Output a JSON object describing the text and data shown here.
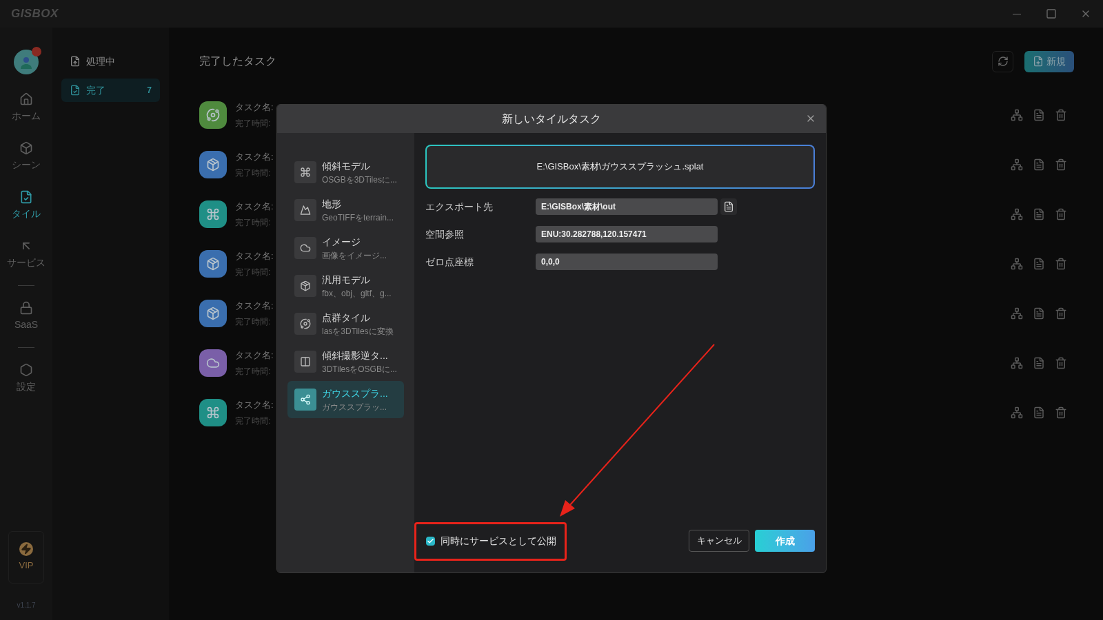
{
  "app": {
    "logo": "GISBOX"
  },
  "avatar": {
    "notification": true
  },
  "nav": {
    "items": [
      {
        "label": "ホーム",
        "selected": false
      },
      {
        "label": "シーン",
        "selected": false
      },
      {
        "label": "タイル",
        "selected": true
      },
      {
        "label": "サービス",
        "selected": false
      }
    ],
    "extra_items": [
      {
        "label": "SaaS",
        "selected": false
      },
      {
        "label": "設定",
        "selected": false
      }
    ]
  },
  "vip": {
    "label": "VIP"
  },
  "version": "v1.1.7",
  "categories": [
    {
      "label": "処理中",
      "selected": false
    },
    {
      "label": "完了",
      "count": "7",
      "selected": true
    }
  ],
  "main": {
    "title": "完了したタスク",
    "new_button": "新規",
    "tasks": [
      {
        "kind": "point_cloud",
        "color": "#4f8a3e",
        "name_label": "タスク名:",
        "time_label": "完了時間:"
      },
      {
        "kind": "model",
        "color": "#3a6eae",
        "name_label": "タスク名:",
        "time_label": "完了時間:"
      },
      {
        "kind": "oblique",
        "color": "#1f8f86",
        "name_label": "タスク名:",
        "time_label": "完了時間:"
      },
      {
        "kind": "model",
        "color": "#3a6eae",
        "name_label": "タスク名:",
        "time_label": "完了時間:"
      },
      {
        "kind": "model",
        "color": "#3a6eae",
        "name_label": "タスク名:",
        "time_label": "完了時間:"
      },
      {
        "kind": "image",
        "color": "#7a5fa8",
        "name_label": "タスク名:",
        "time_label": "完了時間:"
      },
      {
        "kind": "oblique",
        "color": "#1f8f86",
        "name_label": "タスク名:",
        "time_label": "完了時間:"
      }
    ]
  },
  "dialog": {
    "title": "新しいタイルタスク",
    "types": [
      {
        "kind": "oblique",
        "title": "傾斜モデル",
        "subtitle": "OSGBを3DTilesに...",
        "selected": false
      },
      {
        "kind": "terrain",
        "title": "地形",
        "subtitle": "GeoTIFFをterrain...",
        "selected": false
      },
      {
        "kind": "image",
        "title": "イメージ",
        "subtitle": "画像をイメージ...",
        "selected": false
      },
      {
        "kind": "model",
        "title": "汎用モデル",
        "subtitle": "fbx、obj、gltf、g...",
        "selected": false
      },
      {
        "kind": "point_cloud",
        "title": "点群タイル",
        "subtitle": "lasを3DTilesに変換",
        "selected": false
      },
      {
        "kind": "reverse",
        "title": "傾斜撮影逆タ...",
        "subtitle": "3DTilesをOSGBに...",
        "selected": false
      },
      {
        "kind": "gaussian",
        "title": "ガウススプラ...",
        "subtitle": "ガウススプラッ...",
        "selected": true
      }
    ],
    "file_path": "E:\\GISBox\\素材\\ガウススプラッシュ.splat",
    "fields": [
      {
        "kind": "path",
        "label": "エクスポート先",
        "value": "E:\\GISBox\\素材\\out"
      },
      {
        "kind": "text",
        "label": "空間参照",
        "value": "ENU:30.282788,120.157471"
      },
      {
        "kind": "text",
        "label": "ゼロ点座標",
        "value": "0,0,0"
      }
    ],
    "publish": {
      "label": "同時にサービスとして公開",
      "checked": true
    },
    "cancel_button": "キャンセル",
    "create_button": "作成"
  }
}
